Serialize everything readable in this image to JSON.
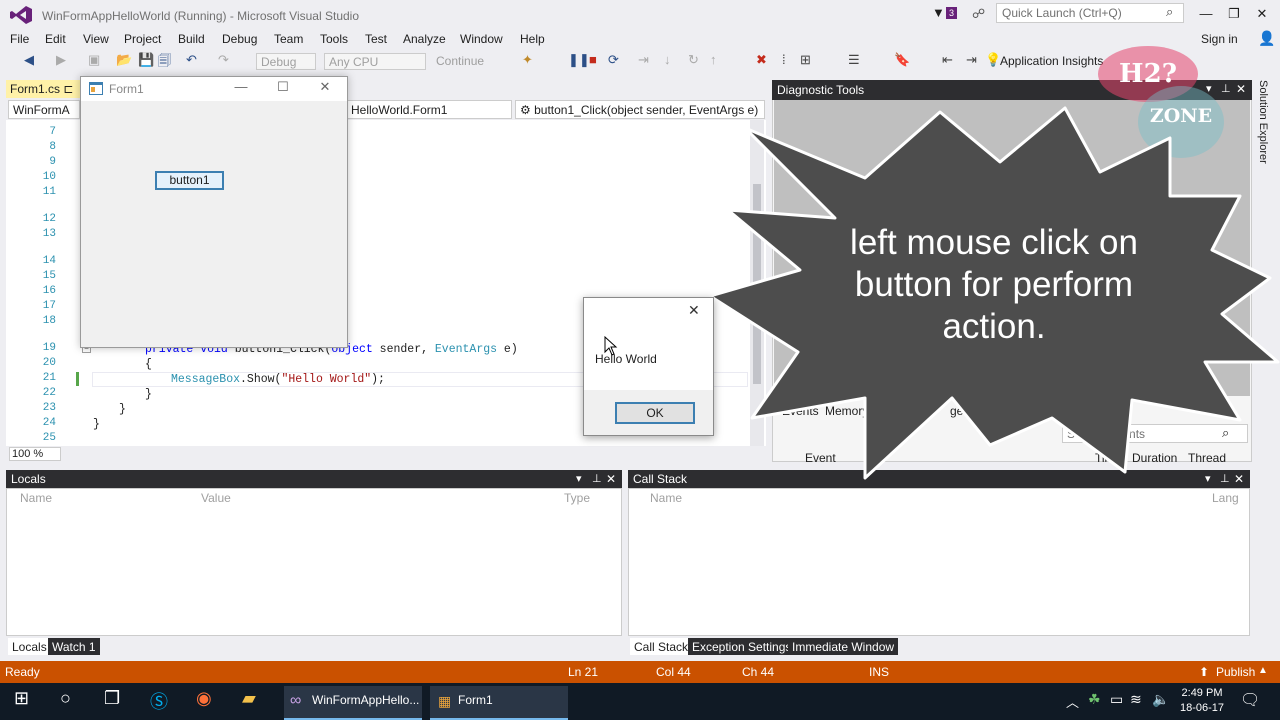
{
  "window": {
    "title": "WinFormAppHelloWorld (Running) - Microsoft Visual Studio",
    "notif_count": "3",
    "quick_launch_placeholder": "Quick Launch (Ctrl+Q)",
    "sign_in": "Sign in"
  },
  "menu": [
    "File",
    "Edit",
    "View",
    "Project",
    "Build",
    "Debug",
    "Team",
    "Tools",
    "Test",
    "Analyze",
    "Window",
    "Help"
  ],
  "toolbar": {
    "config": "Debug",
    "platform": "Any CPU",
    "continue": "Continue",
    "app_insights": "Application Insights"
  },
  "editor": {
    "tab": "Form1.cs",
    "nav_left": "WinFormA",
    "nav_mid": "HelloWorld.Form1",
    "nav_right": "button1_Click(object sender, EventArgs e)",
    "zoom": "100 %",
    "line_numbers": [
      "7",
      "8",
      "9",
      "10",
      "11",
      "12",
      "13",
      "14",
      "15",
      "16",
      "17",
      "18",
      "19",
      "20",
      "21",
      "22",
      "23",
      "24",
      "25"
    ],
    "code": {
      "l19_kw1": "private",
      "l19_kw2": "void",
      "l19_name": " button1_Click(",
      "l19_kw3": "object",
      "l19_mid": " sender, ",
      "l19_ty": "EventArgs",
      "l19_end": " e)",
      "l20": "{",
      "l21_ty": "MessageBox",
      "l21_mid": ".Show(",
      "l21_str": "\"Hello World\"",
      "l21_end": ");",
      "l22": "}",
      "l23": "}",
      "l24": "}"
    }
  },
  "form1": {
    "title": "Form1",
    "button": "button1"
  },
  "diagnostic": {
    "title": "Diagnostic Tools",
    "tabs": [
      "Events",
      "Memory Us",
      "ge"
    ],
    "search_placeholder": "Search Events",
    "columns": [
      "Event",
      "Time",
      "Duration",
      "Thread"
    ]
  },
  "solution_explorer": "Solution Explorer",
  "locals": {
    "title": "Locals",
    "columns": [
      "Name",
      "Value",
      "Type"
    ],
    "tabs": [
      "Locals",
      "Watch 1"
    ]
  },
  "callstack": {
    "title": "Call Stack",
    "columns": [
      "Name",
      "Lang"
    ],
    "tabs": [
      "Call Stack",
      "Exception Settings",
      "Immediate Window"
    ]
  },
  "status": {
    "ready": "Ready",
    "ln": "Ln 21",
    "col": "Col 44",
    "ch": "Ch 44",
    "ins": "INS",
    "publish": "Publish"
  },
  "taskbar": {
    "app1": "WinFormAppHello...",
    "app2": "Form1",
    "time": "2:49 PM",
    "date": "18-06-17"
  },
  "msgbox": {
    "text": "Hello World",
    "ok": "OK"
  },
  "callout": {
    "text": "left mouse click on button for perform action."
  },
  "watermark": {
    "top": "H2?",
    "bottom": "ZONE"
  },
  "colors": {
    "accent": "#68217a",
    "status": "#ca5100",
    "panel_title": "#2d2d30"
  }
}
